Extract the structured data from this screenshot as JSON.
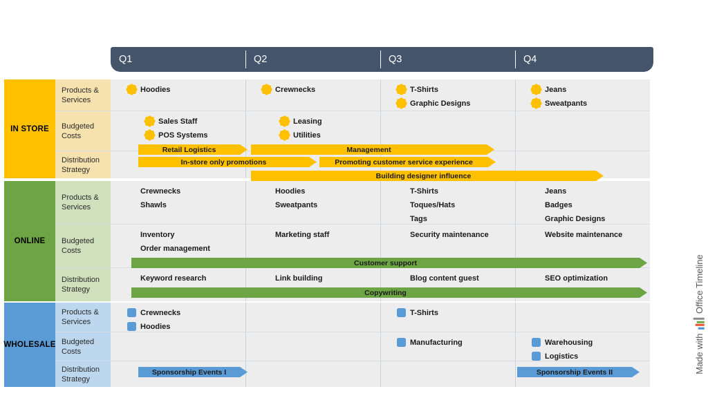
{
  "header": {
    "quarters": [
      {
        "label": "Q1"
      },
      {
        "label": "Q2"
      },
      {
        "label": "Q3"
      },
      {
        "label": "Q4"
      }
    ]
  },
  "watermark": {
    "prefix": "Made with",
    "brand": "Office Timeline",
    "logo_colors": [
      "#4A90D9",
      "#E8542F",
      "#6DA544",
      "#8C8C8C"
    ]
  },
  "row_labels": {
    "products": "Products & Services",
    "budget": "Budgeted Costs",
    "distribution": "Distribution Strategy"
  },
  "colors": {
    "header_bar": "#44546A",
    "in_store": "#FFC000",
    "in_store_tint": "#F5E2AE",
    "online": "#6DA544",
    "online_tint": "#CFE0BC",
    "wholesale": "#5B9BD5",
    "wholesale_tint": "#BDD7EE",
    "row_background": "#EDEDED",
    "gridline": "#D6DCE5"
  },
  "bands": [
    {
      "name": "IN STORE",
      "marker": "star",
      "rows": [
        {
          "label_key": "products",
          "milestones": [
            {
              "quarter": 1,
              "line": 0,
              "text": "Hoodies"
            },
            {
              "quarter": 2,
              "line": 0,
              "text": "Crewnecks"
            },
            {
              "quarter": 3,
              "line": 0,
              "text": "T-Shirts"
            },
            {
              "quarter": 3,
              "line": 1,
              "text": "Graphic Designs"
            },
            {
              "quarter": 4,
              "line": 0,
              "text": "Jeans"
            },
            {
              "quarter": 4,
              "line": 1,
              "text": "Sweatpants"
            }
          ],
          "bars": []
        },
        {
          "label_key": "budget",
          "milestones": [
            {
              "quarter": 1,
              "line": 0,
              "text": "Sales Staff"
            },
            {
              "quarter": 1,
              "line": 1,
              "text": "POS Systems"
            },
            {
              "quarter": 2,
              "line": 0,
              "text": "Leasing"
            },
            {
              "quarter": 2,
              "line": 1,
              "text": "Utilities"
            }
          ],
          "bars": [
            {
              "text": "Retail Logistics",
              "start": 200,
              "end": 358,
              "row": 2
            },
            {
              "text": "Management",
              "start": 363,
              "end": 715,
              "row": 2
            }
          ]
        },
        {
          "label_key": "distribution",
          "milestones": [],
          "bars": [
            {
              "text": "In-store only promotions",
              "start": 200,
              "end": 458,
              "row": 0
            },
            {
              "text": "Promoting customer service experience",
              "start": 462,
              "end": 717,
              "row": 0
            },
            {
              "text": "Building designer influence",
              "start": 363,
              "end": 873,
              "row": 1
            }
          ]
        }
      ]
    },
    {
      "name": "ONLINE",
      "marker": "diamond",
      "rows": [
        {
          "label_key": "products",
          "milestones": [
            {
              "quarter": 1,
              "line": 0,
              "text": "Crewnecks"
            },
            {
              "quarter": 1,
              "line": 1,
              "text": "Shawls"
            },
            {
              "quarter": 2,
              "line": 0,
              "text": "Hoodies"
            },
            {
              "quarter": 2,
              "line": 1,
              "text": "Sweatpants"
            },
            {
              "quarter": 3,
              "line": 0,
              "text": "T-Shirts"
            },
            {
              "quarter": 3,
              "line": 1,
              "text": "Toques/Hats"
            },
            {
              "quarter": 3,
              "line": 2,
              "text": "Tags"
            },
            {
              "quarter": 4,
              "line": 0,
              "text": "Jeans"
            },
            {
              "quarter": 4,
              "line": 1,
              "text": "Badges"
            },
            {
              "quarter": 4,
              "line": 2,
              "text": "Graphic Designs"
            }
          ],
          "bars": []
        },
        {
          "label_key": "budget",
          "milestones": [
            {
              "quarter": 1,
              "line": 0,
              "text": "Inventory"
            },
            {
              "quarter": 1,
              "line": 1,
              "text": "Order management"
            },
            {
              "quarter": 2,
              "line": 0,
              "text": "Marketing staff"
            },
            {
              "quarter": 3,
              "line": 0,
              "text": "Security maintenance"
            },
            {
              "quarter": 4,
              "line": 0,
              "text": "Website maintenance"
            }
          ],
          "bars": [
            {
              "text": "Customer support",
              "start": 190,
              "end": 936,
              "row": 2
            }
          ]
        },
        {
          "label_key": "distribution",
          "milestones": [
            {
              "quarter": 1,
              "line": 0,
              "text": "Keyword research"
            },
            {
              "quarter": 2,
              "line": 0,
              "text": "Link building"
            },
            {
              "quarter": 3,
              "line": 0,
              "text": "Blog content guest"
            },
            {
              "quarter": 4,
              "line": 0,
              "text": "SEO optimization"
            }
          ],
          "bars": [
            {
              "text": "Copywriting",
              "start": 190,
              "end": 936,
              "row": 1
            }
          ]
        }
      ]
    },
    {
      "name": "WHOLESALE",
      "marker": "square",
      "rows": [
        {
          "label_key": "products",
          "milestones": [
            {
              "quarter": 1,
              "line": 0,
              "text": "Crewnecks"
            },
            {
              "quarter": 1,
              "line": 1,
              "text": "Hoodies"
            },
            {
              "quarter": 3,
              "line": 0,
              "text": "T-Shirts"
            }
          ],
          "bars": []
        },
        {
          "label_key": "budget",
          "milestones": [
            {
              "quarter": 3,
              "line": 0,
              "text": "Manufacturing"
            },
            {
              "quarter": 4,
              "line": 0,
              "text": "Warehousing"
            },
            {
              "quarter": 4,
              "line": 1,
              "text": "Logistics"
            }
          ],
          "bars": []
        },
        {
          "label_key": "distribution",
          "milestones": [],
          "bars": [
            {
              "text": "Sponsorship Events I",
              "start": 200,
              "end": 358,
              "row": 0
            },
            {
              "text": "Sponsorship Events II",
              "start": 748,
              "end": 925,
              "row": 0
            }
          ]
        }
      ]
    }
  ]
}
